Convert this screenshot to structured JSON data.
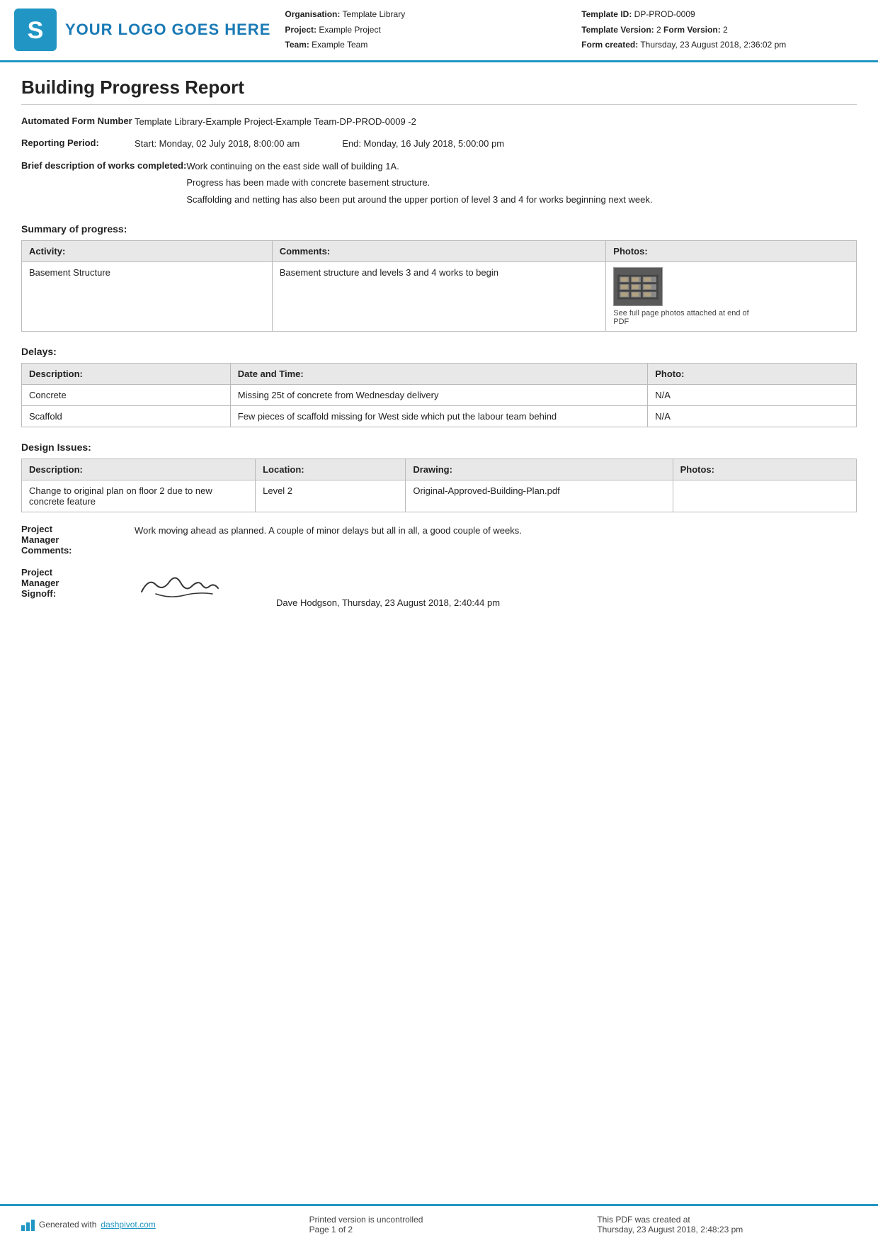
{
  "header": {
    "logo_text": "YOUR LOGO GOES HERE",
    "org_label": "Organisation:",
    "org_value": "Template Library",
    "project_label": "Project:",
    "project_value": "Example Project",
    "team_label": "Team:",
    "team_value": "Example Team",
    "template_id_label": "Template ID:",
    "template_id_value": "DP-PROD-0009",
    "template_version_label": "Template Version:",
    "template_version_value": "2",
    "form_version_label": "Form Version:",
    "form_version_value": "2",
    "form_created_label": "Form created:",
    "form_created_value": "Thursday, 23 August 2018, 2:36:02 pm"
  },
  "report": {
    "title": "Building Progress Report",
    "automated_form_number_label": "Automated Form Number",
    "automated_form_number_value": "Template Library-Example Project-Example Team-DP-PROD-0009   -2",
    "reporting_period_label": "Reporting Period:",
    "reporting_period_start": "Start: Monday, 02 July 2018, 8:00:00 am",
    "reporting_period_end": "End: Monday, 16 July 2018, 5:00:00 pm",
    "brief_description_label": "Brief description of works completed:",
    "brief_description_lines": [
      "Work continuing on the east side wall of building 1A.",
      "Progress has been made with concrete basement structure.",
      "Scaffolding and netting has also been put around the upper portion of level 3 and 4 for works beginning next week."
    ]
  },
  "progress_section": {
    "title": "Summary of progress:",
    "columns": [
      "Activity:",
      "Comments:",
      "Photos:"
    ],
    "rows": [
      {
        "activity": "Basement Structure",
        "comments": "Basement structure and levels 3 and 4 works to begin",
        "photo_caption": "See full page photos attached at end of PDF"
      }
    ]
  },
  "delays_section": {
    "title": "Delays:",
    "columns": [
      "Description:",
      "Date and Time:",
      "Photo:"
    ],
    "rows": [
      {
        "description": "Concrete",
        "date_time": "Missing 25t of concrete from Wednesday delivery",
        "photo": "N/A"
      },
      {
        "description": "Scaffold",
        "date_time": "Few pieces of scaffold missing for West side which put the labour team behind",
        "photo": "N/A"
      }
    ]
  },
  "design_section": {
    "title": "Design Issues:",
    "columns": [
      "Description:",
      "Location:",
      "Drawing:",
      "Photos:"
    ],
    "rows": [
      {
        "description": "Change to original plan on floor 2 due to new concrete feature",
        "location": "Level 2",
        "drawing": "Original-Approved-Building-Plan.pdf",
        "photos": ""
      }
    ]
  },
  "manager_comments": {
    "label": "Project Manager Comments:",
    "value": "Work moving ahead as planned. A couple of minor delays but all in all, a good couple of weeks."
  },
  "manager_signoff": {
    "label": "Project Manager Signoff:",
    "name_date": "Dave Hodgson, Thursday, 23 August 2018, 2:40:44 pm"
  },
  "footer": {
    "generated_text": "Generated with ",
    "dashpivot_link": "dashpivot.com",
    "uncontrolled_text": "Printed version is uncontrolled",
    "page_text": "Page 1 of 2",
    "pdf_created_text": "This PDF was created at",
    "pdf_created_date": "Thursday, 23 August 2018, 2:48:23 pm"
  }
}
